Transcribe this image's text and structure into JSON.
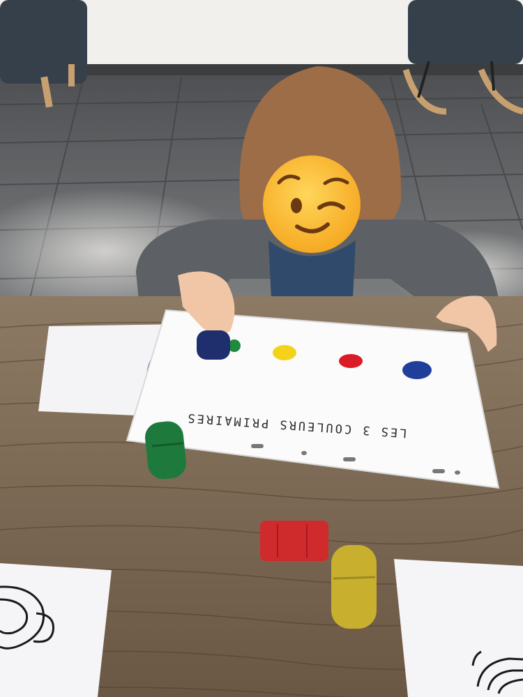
{
  "sheet": {
    "caption": "LES 3 COULEURS PRIMAIRES"
  },
  "colors": {
    "wall": "#f2f1ee",
    "floor": "#5f6265",
    "table": "#7d6a55",
    "paper": "#fbfbfb",
    "paint_green": "#1f8a3c",
    "paint_yellow": "#f4d21a",
    "paint_red": "#d91c26",
    "paint_blue": "#1f3f9a",
    "paint_purple": "#6b2d8f",
    "sweater": "#5d6064",
    "shirt": "#2f4a6b",
    "hair": "#a0704a",
    "skin": "#f0c6a6"
  },
  "icons": {
    "face_cover": "winking-face-emoji-icon"
  }
}
